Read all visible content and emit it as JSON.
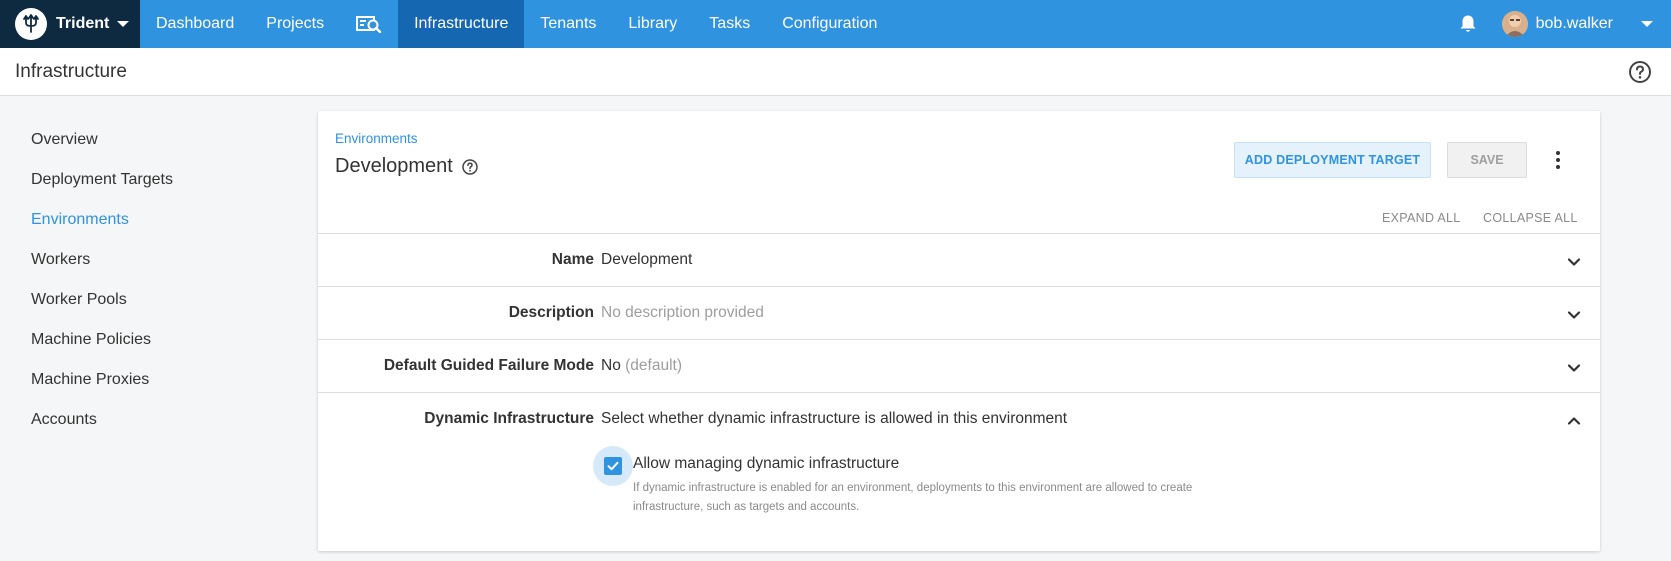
{
  "app": {
    "brand_name": "Trident",
    "brand_icon": "trident-logo-icon"
  },
  "topnav": {
    "items": [
      {
        "label": "Dashboard",
        "active": false
      },
      {
        "label": "Projects",
        "active": false
      },
      {
        "label": "",
        "icon": "search-projects-icon",
        "active": false
      },
      {
        "label": "Infrastructure",
        "active": true
      },
      {
        "label": "Tenants",
        "active": false
      },
      {
        "label": "Library",
        "active": false
      },
      {
        "label": "Tasks",
        "active": false
      },
      {
        "label": "Configuration",
        "active": false
      }
    ],
    "notifications_icon": "bell-icon",
    "username": "bob.walker"
  },
  "page": {
    "title": "Infrastructure",
    "help_icon": "help-circle-icon"
  },
  "sidebar": {
    "items": [
      {
        "label": "Overview",
        "active": false
      },
      {
        "label": "Deployment Targets",
        "active": false
      },
      {
        "label": "Environments",
        "active": true
      },
      {
        "label": "Workers",
        "active": false
      },
      {
        "label": "Worker Pools",
        "active": false
      },
      {
        "label": "Machine Policies",
        "active": false
      },
      {
        "label": "Machine Proxies",
        "active": false
      },
      {
        "label": "Accounts",
        "active": false
      }
    ]
  },
  "environment": {
    "breadcrumb": "Environments",
    "title": "Development",
    "add_target_label": "ADD DEPLOYMENT TARGET",
    "save_label": "SAVE",
    "expand_all_label": "EXPAND ALL",
    "collapse_all_label": "COLLAPSE ALL",
    "rows": [
      {
        "label": "Name",
        "value": "Development",
        "value_muted": "",
        "expanded": false
      },
      {
        "label": "Description",
        "value": "",
        "value_muted": "No description provided",
        "expanded": false
      },
      {
        "label": "Default Guided Failure Mode",
        "value": "No",
        "value_muted": "(default)",
        "expanded": false
      },
      {
        "label": "Dynamic Infrastructure",
        "value": "Select whether dynamic infrastructure is allowed in this environment",
        "value_muted": "",
        "expanded": true
      }
    ],
    "dynamic_checkbox": {
      "label": "Allow managing dynamic infrastructure",
      "checked": true,
      "hint": "If dynamic infrastructure is enabled for an environment, deployments to this environment are allowed to create infrastructure, such as targets and accounts."
    }
  },
  "colors": {
    "nav_blue": "#2f93e0",
    "nav_active": "#1467b0",
    "brand_dark": "#0e2a41",
    "link_blue": "#2f93e0"
  }
}
